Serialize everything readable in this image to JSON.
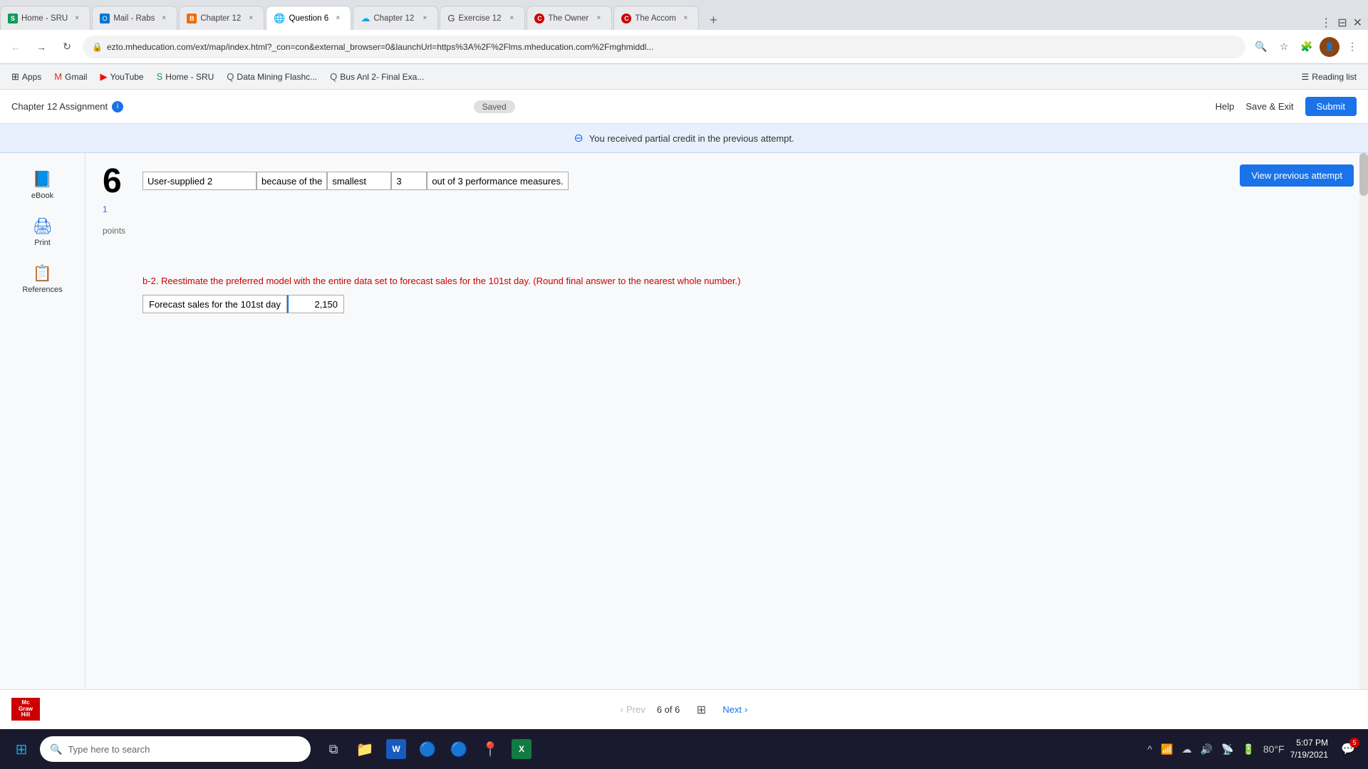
{
  "browser": {
    "tabs": [
      {
        "id": "tab-sheets",
        "favicon_type": "sheets",
        "title": "Home - SRU",
        "active": false
      },
      {
        "id": "tab-outlook",
        "favicon_type": "outlook",
        "title": "Mail - Rabs",
        "active": false
      },
      {
        "id": "tab-bitly",
        "favicon_type": "bitly",
        "title": "Chapter 12",
        "active": false
      },
      {
        "id": "tab-question6",
        "favicon_type": "globe",
        "title": "Question 6",
        "active": true
      },
      {
        "id": "tab-chapter12b",
        "favicon_type": "cloud",
        "title": "Chapter 12",
        "active": false
      },
      {
        "id": "tab-exercise12",
        "favicon_type": "google",
        "title": "Exercise 12",
        "active": false
      },
      {
        "id": "tab-owner",
        "favicon_type": "circle-c",
        "title": "The Owner",
        "active": false
      },
      {
        "id": "tab-accomp",
        "favicon_type": "circle-c",
        "title": "The Accom",
        "active": false
      }
    ],
    "url": "ezto.mheducation.com/ext/map/index.html?_con=con&external_browser=0&launchUrl=https%3A%2F%2Flms.mheducation.com%2Fmghmiddl...",
    "bookmarks": [
      {
        "id": "bm-apps",
        "icon": "⊞",
        "label": "Apps"
      },
      {
        "id": "bm-gmail",
        "icon": "M",
        "label": "Gmail"
      },
      {
        "id": "bm-youtube",
        "icon": "▶",
        "label": "YouTube"
      },
      {
        "id": "bm-home-sru",
        "icon": "S",
        "label": "Home - SRU"
      },
      {
        "id": "bm-datamining",
        "icon": "Q",
        "label": "Data Mining Flashc..."
      },
      {
        "id": "bm-busanl",
        "icon": "Q",
        "label": "Bus Anl 2- Final Exa..."
      }
    ],
    "reading_list": "Reading list"
  },
  "app_header": {
    "title": "Chapter 12 Assignment",
    "saved_label": "Saved",
    "help_label": "Help",
    "save_exit_label": "Save & Exit",
    "submit_label": "Submit"
  },
  "notice": {
    "text": "You received partial credit in the previous attempt."
  },
  "question": {
    "number": "6",
    "points": "1",
    "points_label": "points",
    "view_prev_label": "View previous attempt",
    "sentence_parts": {
      "field1_value": "User-supplied 2",
      "text1": "because of the",
      "field2_value": "smallest",
      "field3_value": "3",
      "text2": "out of 3 performance measures."
    },
    "b2_label": "b-2. Reestimate the preferred model with the entire data set to forecast sales for the 101st day.",
    "b2_note": "(Round final answer to the nearest whole number.)",
    "forecast_label": "Forecast sales for the 101st day",
    "forecast_value": "2,150"
  },
  "pagination": {
    "prev_label": "Prev",
    "next_label": "Next",
    "current": "6",
    "of": "of",
    "total": "6"
  },
  "taskbar": {
    "search_placeholder": "Type here to search",
    "time": "5:07 PM",
    "date": "7/19/2021",
    "notification_count": "5",
    "weather": "80°F"
  },
  "sidebar": {
    "tools": [
      {
        "id": "ebook",
        "icon": "📘",
        "label": "eBook"
      },
      {
        "id": "print",
        "icon": "🖨",
        "label": "Print"
      },
      {
        "id": "references",
        "icon": "📋",
        "label": "References"
      }
    ]
  }
}
